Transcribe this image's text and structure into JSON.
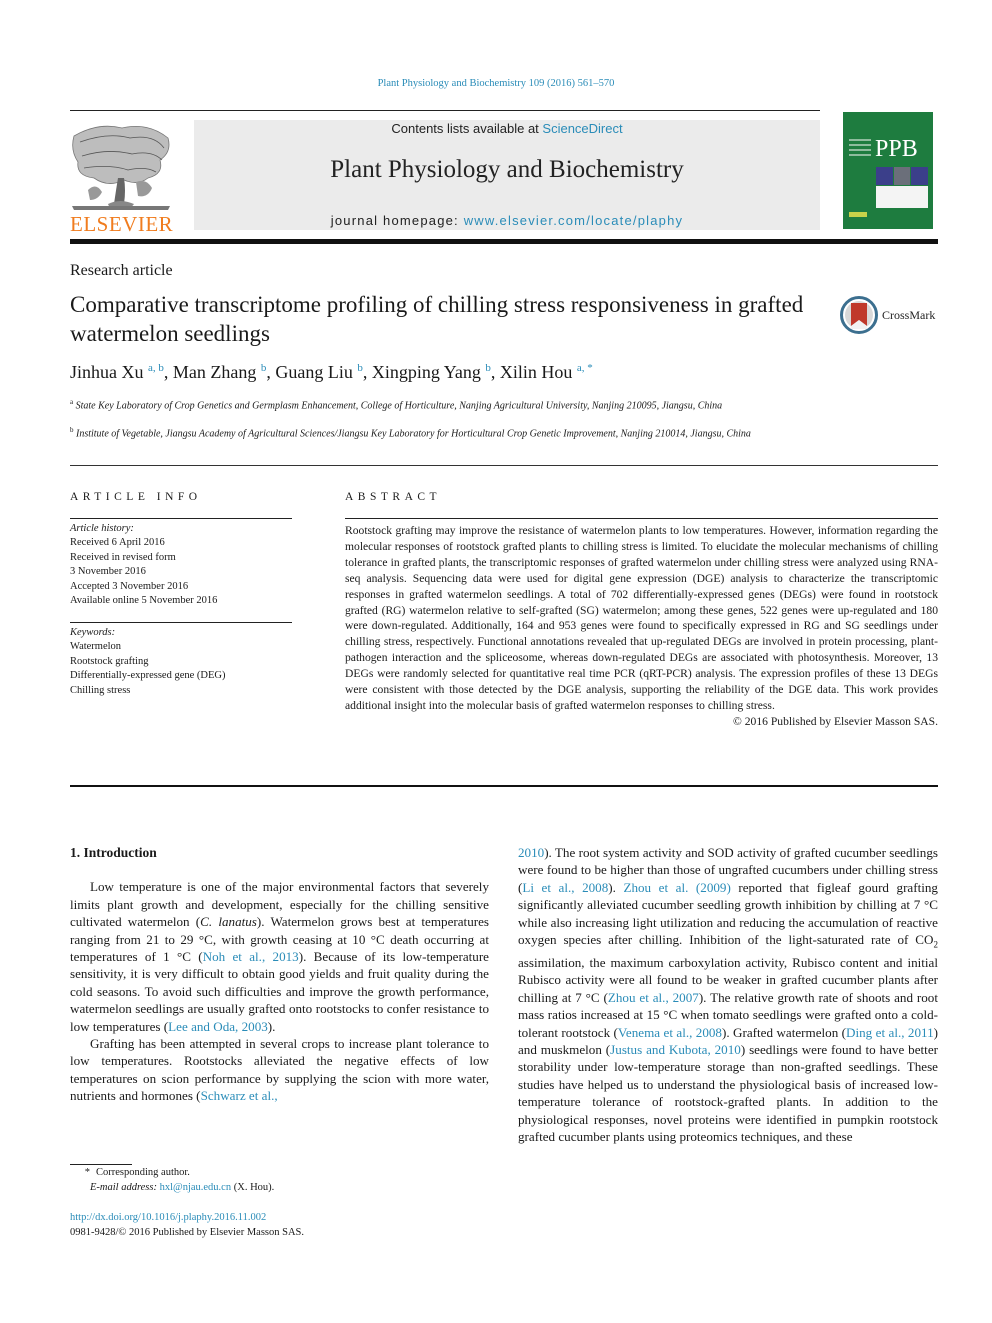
{
  "running_head": "Plant Physiology and Biochemistry 109 (2016) 561–570",
  "masthead": {
    "publisher_logo": "ELSEVIER",
    "contents_prefix": "Contents lists available at ",
    "contents_link": "ScienceDirect",
    "journal_title": "Plant Physiology and Biochemistry",
    "homepage_prefix": "journal homepage: ",
    "homepage_link": "www.elsevier.com/locate/plaphy",
    "cover_abbrev": "PPB"
  },
  "article": {
    "type": "Research article",
    "title": "Comparative transcriptome profiling of chilling stress responsiveness in grafted watermelon seedlings",
    "crossmark_label": "CrossMark",
    "authors": [
      {
        "name": "Jinhua Xu",
        "sup": "a, b"
      },
      {
        "name": "Man Zhang",
        "sup": "b"
      },
      {
        "name": "Guang Liu",
        "sup": "b"
      },
      {
        "name": "Xingping Yang",
        "sup": "b"
      },
      {
        "name": "Xilin Hou",
        "sup": "a, *"
      }
    ],
    "affiliations": [
      {
        "mark": "a",
        "text": "State Key Laboratory of Crop Genetics and Germplasm Enhancement, College of Horticulture, Nanjing Agricultural University, Nanjing 210095, Jiangsu, China"
      },
      {
        "mark": "b",
        "text": "Institute of Vegetable, Jiangsu Academy of Agricultural Sciences/Jiangsu Key Laboratory for Horticultural Crop Genetic Improvement, Nanjing 210014, Jiangsu, China"
      }
    ]
  },
  "article_info": {
    "heading": "ARTICLE INFO",
    "history_label": "Article history:",
    "history": [
      "Received 6 April 2016",
      "Received in revised form",
      "3 November 2016",
      "Accepted 3 November 2016",
      "Available online 5 November 2016"
    ],
    "keywords_label": "Keywords:",
    "keywords": [
      "Watermelon",
      "Rootstock grafting",
      "Differentially-expressed gene (DEG)",
      "Chilling stress"
    ]
  },
  "abstract": {
    "heading": "ABSTRACT",
    "text": "Rootstock grafting may improve the resistance of watermelon plants to low temperatures. However, information regarding the molecular responses of rootstock grafted plants to chilling stress is limited. To elucidate the molecular mechanisms of chilling tolerance in grafted plants, the transcriptomic responses of grafted watermelon under chilling stress were analyzed using RNA-seq analysis. Sequencing data were used for digital gene expression (DGE) analysis to characterize the transcriptomic responses in grafted watermelon seedlings. A total of 702 differentially-expressed genes (DEGs) were found in rootstock grafted (RG) watermelon relative to self-grafted (SG) watermelon; among these genes, 522 genes were up-regulated and 180 were down-regulated. Additionally, 164 and 953 genes were found to specifically expressed in RG and SG seedlings under chilling stress, respectively. Functional annotations revealed that up-regulated DEGs are involved in protein processing, plant-pathogen interaction and the spliceosome, whereas down-regulated DEGs are associated with photosynthesis. Moreover, 13 DEGs were randomly selected for quantitative real time PCR (qRT-PCR) analysis. The expression profiles of these 13 DEGs were consistent with those detected by the DGE analysis, supporting the reliability of the DGE data. This work provides additional insight into the molecular basis of grafted watermelon responses to chilling stress.",
    "copyright": "© 2016 Published by Elsevier Masson SAS."
  },
  "introduction": {
    "heading": "1.  Introduction",
    "p1": [
      {
        "t": "Low temperature is one of the major environmental factors that severely limits plant growth and development, especially for the chilling sensitive cultivated watermelon ("
      },
      {
        "t": "C. lanatus",
        "i": true
      },
      {
        "t": "). Watermelon grows best at temperatures ranging from 21 to 29 °C, with growth ceasing at 10 °C death occurring at temperatures of 1 °C ("
      },
      {
        "t": "Noh et al., 2013",
        "link": true
      },
      {
        "t": "). Because of its low-temperature sensitivity, it is very difficult to obtain good yields and fruit quality during the cold seasons. To avoid such difficulties and improve the growth performance, watermelon seedlings are usually grafted onto rootstocks to confer resistance to low temperatures ("
      },
      {
        "t": "Lee and Oda, 2003",
        "link": true
      },
      {
        "t": ")."
      }
    ],
    "p2": [
      {
        "t": "Grafting has been attempted in several crops to increase plant tolerance to low temperatures. Rootstocks alleviated the negative effects of low temperatures on scion performance by supplying the scion with more water, nutrients and hormones ("
      },
      {
        "t": "Schwarz et al.,",
        "link": true
      }
    ],
    "p2_cont": [
      {
        "t": "2010",
        "link": true
      },
      {
        "t": "). The root system activity and SOD activity of grafted cucumber seedlings were found to be higher than those of ungrafted cucumbers under chilling stress ("
      },
      {
        "t": "Li et al., 2008",
        "link": true
      },
      {
        "t": "). "
      },
      {
        "t": "Zhou et al. (2009)",
        "link": true
      },
      {
        "t": " reported that figleaf gourd grafting significantly alleviated cucumber seedling growth inhibition by chilling at 7 °C while also increasing light utilization and reducing the accumulation of reactive oxygen species after chilling. Inhibition of the light-saturated rate of CO"
      },
      {
        "t": "2",
        "sub": true
      },
      {
        "t": " assimilation, the maximum carboxylation activity, Rubisco content and initial Rubisco activity were all found to be weaker in grafted cucumber plants after chilling at 7 °C ("
      },
      {
        "t": "Zhou et al., 2007",
        "link": true
      },
      {
        "t": "). The relative growth rate of shoots and root mass ratios increased at 15 °C when tomato seedlings were grafted onto a cold-tolerant rootstock ("
      },
      {
        "t": "Venema et al., 2008",
        "link": true
      },
      {
        "t": "). Grafted watermelon ("
      },
      {
        "t": "Ding et al., 2011",
        "link": true
      },
      {
        "t": ") and muskmelon ("
      },
      {
        "t": "Justus and Kubota, 2010",
        "link": true
      },
      {
        "t": ") seedlings were found to have better storability under low-temperature storage than non-grafted seedlings. These studies have helped us to understand the physiological basis of increased low-temperature tolerance of rootstock-grafted plants. In addition to the physiological responses, novel proteins were identified in pumpkin rootstock grafted cucumber plants using proteomics techniques, and these"
      }
    ]
  },
  "footnote": {
    "star": "*",
    "corresponding": "Corresponding author.",
    "email_label": "E-mail address:",
    "email": "hxl@njau.edu.cn",
    "email_suffix": " (X. Hou).",
    "doi": "http://dx.doi.org/10.1016/j.plaphy.2016.11.002",
    "issn_line": "0981-9428/© 2016 Published by Elsevier Masson SAS."
  },
  "colors": {
    "link": "#2a8cb8",
    "elsevier_orange": "#f07c1e",
    "cover_green": "#1e7c3f",
    "masthead_gray": "#ebebeb"
  }
}
